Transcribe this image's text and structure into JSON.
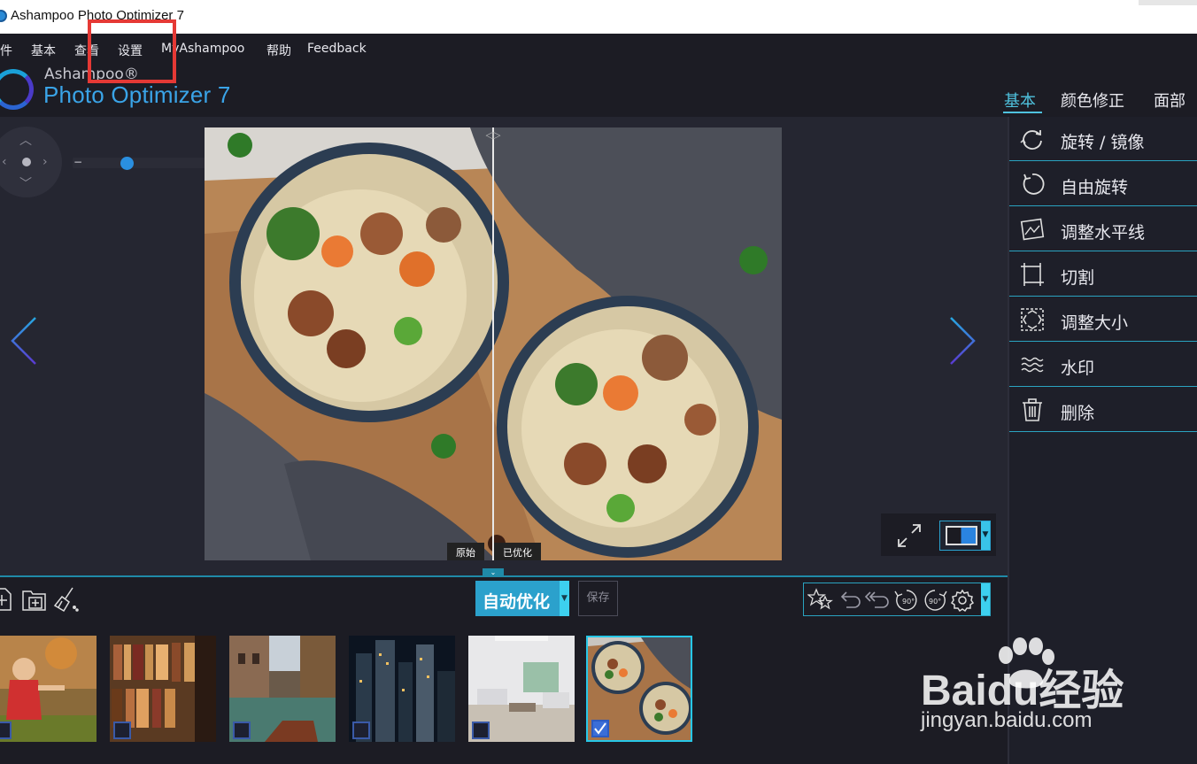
{
  "window": {
    "title": "Ashampoo Photo Optimizer 7"
  },
  "menu": [
    "文件",
    "基本",
    "查看",
    "设置",
    "MyAshampoo",
    "帮助",
    "Feedback"
  ],
  "logo": {
    "brand": "Ashampoo®",
    "product": "Photo Optimizer 7"
  },
  "tabs": [
    {
      "label": "基本",
      "active": true
    },
    {
      "label": "颜色修正",
      "active": false
    },
    {
      "label": "面部",
      "active": false
    }
  ],
  "zoom": {
    "minus": "−",
    "plus": "+",
    "level": 0.35
  },
  "viewer": {
    "label_original": "原始",
    "label_optimized": "已优化",
    "split_position": 0.5
  },
  "side_tools": [
    {
      "label": "旋转 / 镜像",
      "icon": "rotate-icon"
    },
    {
      "label": "自由旋转",
      "icon": "free-rotate-icon"
    },
    {
      "label": "调整水平线",
      "icon": "horizon-icon"
    },
    {
      "label": "切割",
      "icon": "crop-icon"
    },
    {
      "label": "调整大小",
      "icon": "resize-icon"
    },
    {
      "label": "水印",
      "icon": "watermark-icon"
    },
    {
      "label": "删除",
      "icon": "trash-icon"
    }
  ],
  "toolbar": {
    "auto_optimize": "自动优化",
    "save": "保存",
    "rotate_left_label": "90°",
    "rotate_right_label": "90°"
  },
  "thumbnails": [
    {
      "name": "child-photo",
      "checked": false,
      "selected": false
    },
    {
      "name": "bookshelf-photo",
      "checked": false,
      "selected": false
    },
    {
      "name": "canal-photo",
      "checked": false,
      "selected": false
    },
    {
      "name": "city-night-photo",
      "checked": false,
      "selected": false
    },
    {
      "name": "living-room-photo",
      "checked": false,
      "selected": false
    },
    {
      "name": "noodle-bowls-photo",
      "checked": true,
      "selected": true
    }
  ],
  "watermark": {
    "brand": "Bai",
    "brand_suffix": "du经验",
    "url": "jingyan.baidu.com"
  },
  "colors": {
    "accent": "#27c7e7",
    "panel": "#252631",
    "bg": "#1c1c24",
    "highlight": "#e53935"
  }
}
